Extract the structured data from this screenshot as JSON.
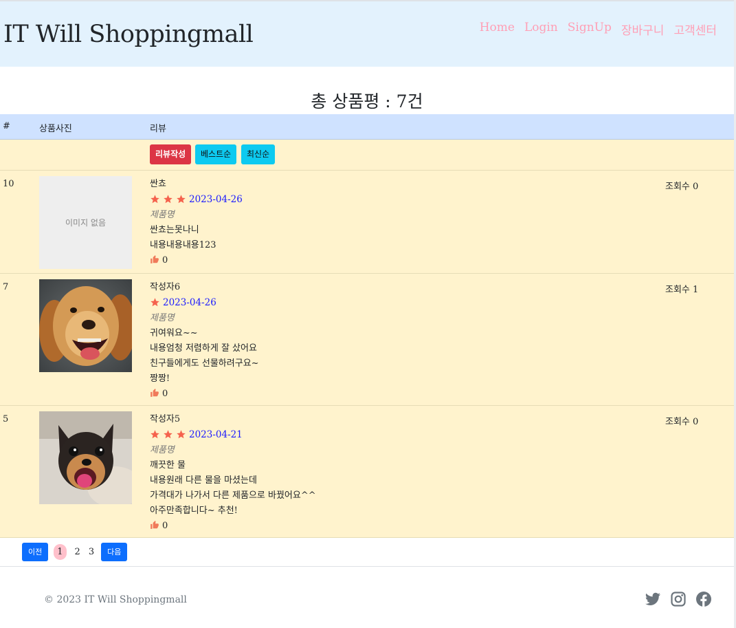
{
  "header": {
    "brand": "IT Will Shoppingmall",
    "nav": [
      "Home",
      "Login",
      "SignUp",
      "장바구니",
      "고객센터"
    ]
  },
  "page_title": "총 상품평 : 7건",
  "table": {
    "columns": [
      "#",
      "상품사진",
      "리뷰"
    ],
    "buttons": {
      "write": "리뷰작성",
      "best": "베스트순",
      "latest": "최신순"
    },
    "reviews": [
      {
        "num": "10",
        "image": "이미지 없음",
        "author": "싼쵸",
        "stars": 3,
        "date": "2023-04-26",
        "product": "제품명",
        "lines": [
          "싼쵸는못나니",
          "내용내용내용123"
        ],
        "likes": "0",
        "views": "조회수 0"
      },
      {
        "num": "7",
        "image": "golden-retriever-photo",
        "author": "작성자6",
        "stars": 1,
        "date": "2023-04-26",
        "product": "제품명",
        "lines": [
          "귀여워요~~",
          "내용엄청 저렴하게 잘 샀어요",
          "친구들에게도 선물하려구요~",
          "짱짱!"
        ],
        "likes": "0",
        "views": "조회수 1"
      },
      {
        "num": "5",
        "image": "chihuahua-photo",
        "author": "작성자5",
        "stars": 3,
        "date": "2023-04-21",
        "product": "제품명",
        "lines": [
          "깨끗한 물",
          "내용원래 다른 물을 마셨는데",
          "가격대가 나가서 다른 제품으로 바꿨어요^^",
          "아주만족합니다~ 추천!"
        ],
        "likes": "0",
        "views": "조회수 0"
      }
    ]
  },
  "pagination": {
    "prev": "이전",
    "pages": [
      "1",
      "2",
      "3"
    ],
    "active": "1",
    "next": "다음"
  },
  "footer": {
    "copyright": "© 2023 IT Will Shoppingmall",
    "social_icons": [
      "twitter-icon",
      "instagram-icon",
      "facebook-icon"
    ]
  },
  "colors": {
    "header_bg": "#e3f2fd",
    "nav_link": "#ff9fb5",
    "row_bg": "#fff3cd",
    "thead_bg": "#cfe2ff",
    "star": "#f5624d",
    "date": "#1a1aff",
    "primary": "#0d6efd"
  }
}
